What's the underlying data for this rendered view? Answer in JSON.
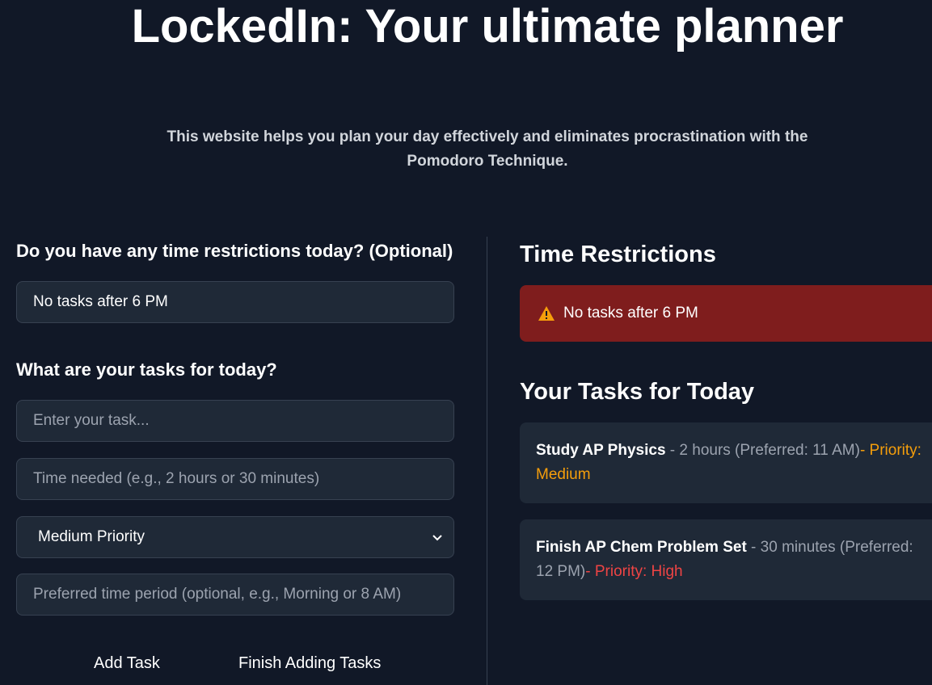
{
  "header": {
    "title": "LockedIn: Your ultimate planner",
    "subtitle_line1": "This website helps you plan your day effectively and eliminates procrastination with the",
    "subtitle_line2": "Pomodoro Technique."
  },
  "form": {
    "restrictions_label": "Do you have any time restrictions today? (Optional)",
    "restrictions_value": "No tasks after 6 PM",
    "tasks_label": "What are your tasks for today?",
    "task_placeholder": "Enter your task...",
    "time_placeholder": "Time needed (e.g., 2 hours or 30 minutes)",
    "priority_selected": "Medium Priority",
    "preferred_placeholder": "Preferred time period (optional, e.g., Morning or 8 AM)",
    "add_button": "Add Task",
    "finish_button": "Finish Adding Tasks"
  },
  "summary": {
    "restrictions_heading": "Time Restrictions",
    "restriction_text": "No tasks after 6 PM",
    "tasks_heading": "Your Tasks for Today",
    "tasks": [
      {
        "name": "Study AP Physics",
        "sep": " - ",
        "line1_detail": "2 hours (Preferred: 11 AM)",
        "line1_priority": "- Priority:",
        "line2_detail": "",
        "line2_priority": "Medium"
      },
      {
        "name": "Finish AP Chem Problem Set",
        "sep": " - ",
        "line1_detail": "30 minutes (Preferred:",
        "line1_priority": "",
        "line2_detail": "12 PM)",
        "line2_priority": "- Priority: High"
      }
    ]
  },
  "colors": {
    "background": "#111827",
    "card": "#1f2937",
    "alert": "#7f1d1d",
    "priority_medium": "#f59e0b",
    "priority_high": "#ef4444",
    "warning_icon": "#f59e0b"
  },
  "icons": {
    "restriction": "warning-triangle-icon",
    "select": "chevron-down-icon"
  }
}
